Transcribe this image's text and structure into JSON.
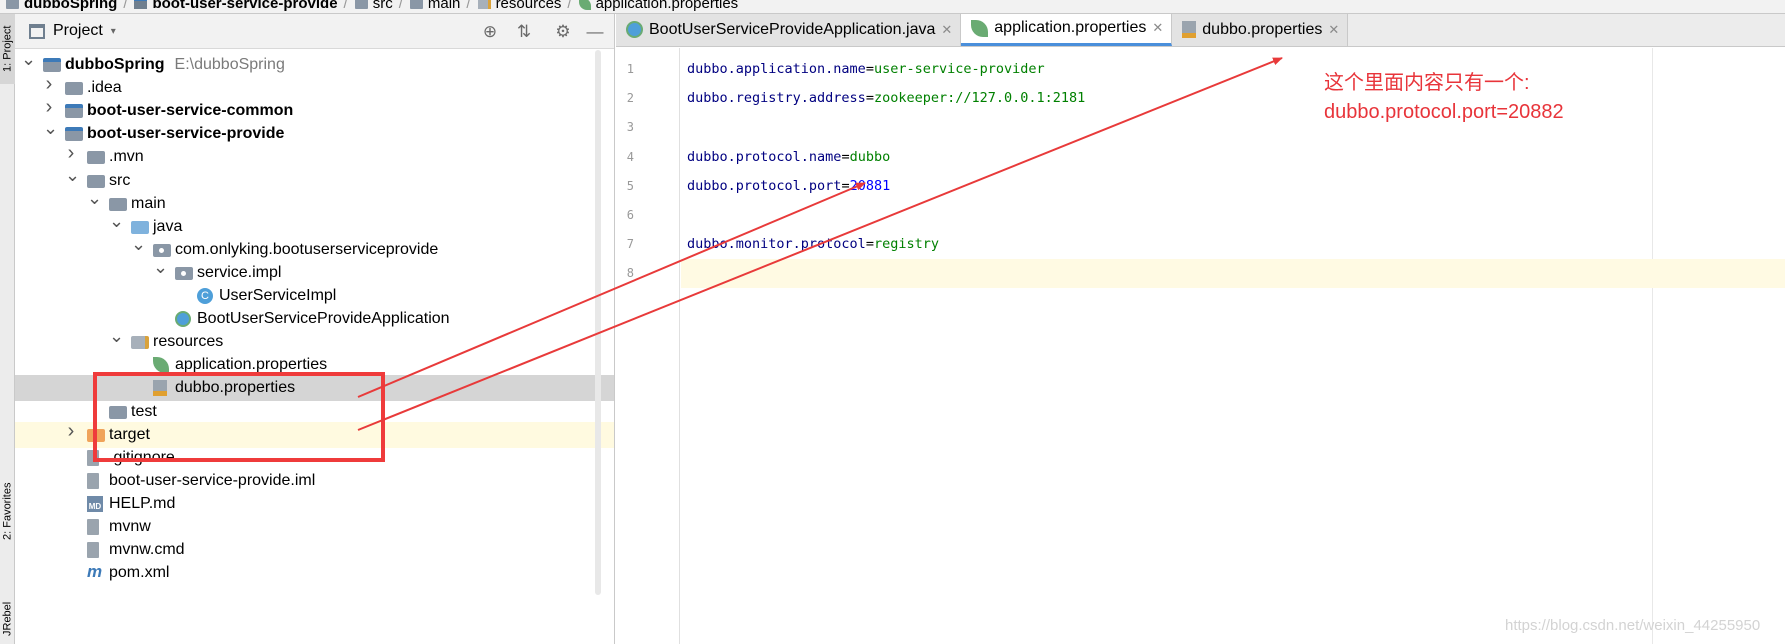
{
  "breadcrumb": [
    {
      "label": "dubboSpring",
      "icon": "folder-icon",
      "bold": true
    },
    {
      "label": "boot-user-service-provide",
      "icon": "module-icon",
      "bold": true
    },
    {
      "label": "src",
      "icon": "folder-icon",
      "bold": false
    },
    {
      "label": "main",
      "icon": "folder-icon",
      "bold": false
    },
    {
      "label": "resources",
      "icon": "resources-folder-icon",
      "bold": false
    },
    {
      "label": "application.properties",
      "icon": "spring-leaf-icon",
      "bold": false
    }
  ],
  "left_strip": {
    "project": "1: Project",
    "favorites": "2: Favorites",
    "jrebel": "JRebel"
  },
  "project_panel": {
    "title": "Project",
    "dropdown": "▾",
    "tree": [
      {
        "label": "dubboSpring",
        "hint": "E:\\dubboSpring",
        "depth": 0,
        "arrow": "expanded",
        "icon": "module",
        "bold": true
      },
      {
        "label": ".idea",
        "depth": 1,
        "arrow": "collapsed",
        "icon": "folder"
      },
      {
        "label": "boot-user-service-common",
        "depth": 1,
        "arrow": "collapsed",
        "icon": "module",
        "bold": true
      },
      {
        "label": "boot-user-service-provide",
        "depth": 1,
        "arrow": "expanded",
        "icon": "module",
        "bold": true
      },
      {
        "label": ".mvn",
        "depth": 2,
        "arrow": "collapsed",
        "icon": "folder"
      },
      {
        "label": "src",
        "depth": 2,
        "arrow": "expanded",
        "icon": "folder"
      },
      {
        "label": "main",
        "depth": 3,
        "arrow": "expanded",
        "icon": "folder"
      },
      {
        "label": "java",
        "depth": 4,
        "arrow": "expanded",
        "icon": "folder-blue"
      },
      {
        "label": "com.onlyking.bootuserserviceprovide",
        "depth": 5,
        "arrow": "expanded",
        "icon": "package"
      },
      {
        "label": "service.impl",
        "depth": 6,
        "arrow": "expanded",
        "icon": "package"
      },
      {
        "label": "UserServiceImpl",
        "depth": 7,
        "arrow": "none",
        "icon": "class"
      },
      {
        "label": "BootUserServiceProvideApplication",
        "depth": 6,
        "arrow": "none",
        "icon": "springclass"
      },
      {
        "label": "resources",
        "depth": 4,
        "arrow": "expanded",
        "icon": "resfolder"
      },
      {
        "label": "application.properties",
        "depth": 5,
        "arrow": "none",
        "icon": "spring"
      },
      {
        "label": "dubbo.properties",
        "depth": 5,
        "arrow": "none",
        "icon": "props",
        "selected": true
      },
      {
        "label": "test",
        "depth": 3,
        "arrow": "none",
        "icon": "folder"
      },
      {
        "label": "target",
        "depth": 2,
        "arrow": "collapsed",
        "icon": "folder-orange",
        "excluded": true
      },
      {
        "label": ".gitignore",
        "depth": 2,
        "arrow": "none",
        "icon": "file"
      },
      {
        "label": "boot-user-service-provide.iml",
        "depth": 2,
        "arrow": "none",
        "icon": "file"
      },
      {
        "label": "HELP.md",
        "depth": 2,
        "arrow": "none",
        "icon": "md"
      },
      {
        "label": "mvnw",
        "depth": 2,
        "arrow": "none",
        "icon": "file"
      },
      {
        "label": "mvnw.cmd",
        "depth": 2,
        "arrow": "none",
        "icon": "file"
      },
      {
        "label": "pom.xml",
        "depth": 2,
        "arrow": "none",
        "icon": "maven"
      }
    ]
  },
  "editor": {
    "tabs": [
      {
        "label": "BootUserServiceProvideApplication.java",
        "icon": "spring-class-icon",
        "active": false
      },
      {
        "label": "application.properties",
        "icon": "spring-leaf-icon",
        "active": true
      },
      {
        "label": "dubbo.properties",
        "icon": "properties-file-icon",
        "active": false
      }
    ],
    "lines": [
      {
        "num": "1",
        "key": "dubbo.application.name",
        "value": "user-service-provider",
        "value_type": "string"
      },
      {
        "num": "2",
        "key": "dubbo.registry.address",
        "value": "zookeeper://127.0.0.1:2181",
        "value_type": "string"
      },
      {
        "num": "3",
        "key": "",
        "value": "",
        "value_type": "string"
      },
      {
        "num": "4",
        "key": "dubbo.protocol.name",
        "value": "dubbo",
        "value_type": "string"
      },
      {
        "num": "5",
        "key": "dubbo.protocol.port",
        "value": "20881",
        "value_type": "number"
      },
      {
        "num": "6",
        "key": "",
        "value": "",
        "value_type": "string"
      },
      {
        "num": "7",
        "key": "dubbo.monitor.protocol",
        "value": "registry",
        "value_type": "string"
      },
      {
        "num": "8",
        "key": "",
        "value": "",
        "value_type": "string",
        "current": true
      }
    ]
  },
  "annotation": {
    "line1": "这个里面内容只有一个:",
    "line2": "dubbo.protocol.port=20882",
    "color": "#e8343a"
  },
  "watermark": "https://blog.csdn.net/weixin_44255950"
}
